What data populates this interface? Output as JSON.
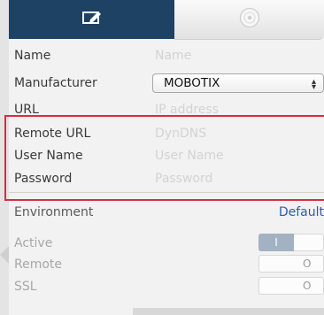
{
  "tabs": [
    {
      "icon": "edit-icon",
      "active": true
    },
    {
      "icon": "disc-icon",
      "active": false
    }
  ],
  "form": {
    "name": {
      "label": "Name",
      "placeholder": "Name"
    },
    "manufacturer": {
      "label": "Manufacturer",
      "value": "MOBOTIX"
    },
    "url": {
      "label": "URL",
      "placeholder": "IP address"
    },
    "remote_url": {
      "label": "Remote URL",
      "placeholder": "DynDNS"
    },
    "user_name": {
      "label": "User Name",
      "placeholder": "User Name"
    },
    "password": {
      "label": "Password",
      "placeholder": "Password"
    }
  },
  "environment": {
    "label": "Environment",
    "link": "Default"
  },
  "toggles": {
    "active": {
      "label": "Active",
      "on_text": "I"
    },
    "remote": {
      "label": "Remote",
      "off_text": "O"
    },
    "ssl": {
      "label": "SSL",
      "off_text": "O"
    }
  },
  "colors": {
    "tab_active": "#1d4264",
    "highlight": "#d92b42",
    "link": "#2c5dab"
  }
}
